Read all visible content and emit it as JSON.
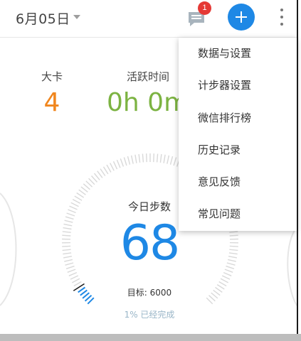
{
  "header": {
    "date": "6月05日",
    "message_badge_count": "1"
  },
  "stats": {
    "kcal_label": "大卡",
    "kcal_value": "4",
    "active_time_label": "活跃时间",
    "active_time_value": "0h 0m"
  },
  "steps": {
    "label": "今日步数",
    "value": "68",
    "target": "目标: 6000",
    "progress_text": "1% 已经完成",
    "progress_fraction": 0.01
  },
  "menu": {
    "items": [
      {
        "label": "数据与设置"
      },
      {
        "label": "计步器设置"
      },
      {
        "label": "微信排行榜"
      },
      {
        "label": "历史记录"
      },
      {
        "label": "意见反馈"
      },
      {
        "label": "常见问题"
      }
    ]
  },
  "colors": {
    "accent": "#1e88e5",
    "kcal": "#f0861e",
    "active": "#7cb342",
    "badge": "#e53935",
    "tick": "#d9d9d9"
  },
  "icons": {
    "message": "chat-bubble-icon",
    "add": "plus-icon",
    "more": "more-vertical-icon",
    "dropdown": "caret-down-icon"
  }
}
